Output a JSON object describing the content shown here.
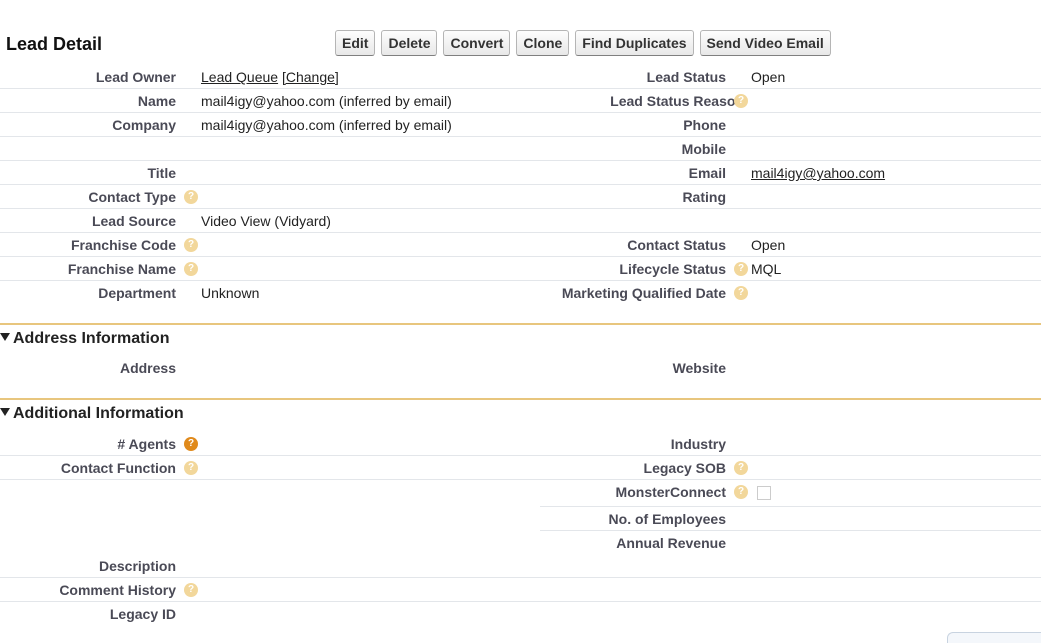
{
  "header": {
    "title": "Lead Detail"
  },
  "buttons": [
    "Edit",
    "Delete",
    "Convert",
    "Clone",
    "Find Duplicates",
    "Send Video Email"
  ],
  "detail": {
    "lead_owner_label": "Lead Owner",
    "lead_owner_value": "Lead Queue",
    "change_link": "[Change]",
    "lead_status_label": "Lead Status",
    "lead_status_value": "Open",
    "name_label": "Name",
    "name_value": "mail4igy@yahoo.com (inferred by email)",
    "lead_status_reason_label": "Lead Status Reason",
    "company_label": "Company",
    "company_value": "mail4igy@yahoo.com (inferred by email)",
    "phone_label": "Phone",
    "mobile_label": "Mobile",
    "title_label": "Title",
    "email_label": "Email",
    "email_value": "mail4igy@yahoo.com",
    "contact_type_label": "Contact Type",
    "rating_label": "Rating",
    "lead_source_label": "Lead Source",
    "lead_source_value": "Video View (Vidyard)",
    "franchise_code_label": "Franchise Code",
    "contact_status_label": "Contact Status",
    "contact_status_value": "Open",
    "franchise_name_label": "Franchise Name",
    "lifecycle_status_label": "Lifecycle Status",
    "lifecycle_status_value": "MQL",
    "department_label": "Department",
    "department_value": "Unknown",
    "mqd_label": "Marketing Qualified Date"
  },
  "address_section": {
    "title": "Address Information",
    "address_label": "Address",
    "website_label": "Website"
  },
  "additional_section": {
    "title": "Additional Information",
    "agents_label": "# Agents",
    "industry_label": "Industry",
    "contact_function_label": "Contact Function",
    "legacy_sob_label": "Legacy SOB",
    "monsterconnect_label": "MonsterConnect",
    "employees_label": "No. of Employees",
    "annual_revenue_label": "Annual Revenue",
    "description_label": "Description",
    "comment_history_label": "Comment History",
    "legacy_id_label": "Legacy ID"
  },
  "icons": {
    "help": "help-icon",
    "collapse": "collapse-triangle-icon"
  },
  "colors": {
    "section_border": "#e8c67e",
    "help_icon": "#f2d79b",
    "help_icon_active": "#e08a1c"
  }
}
